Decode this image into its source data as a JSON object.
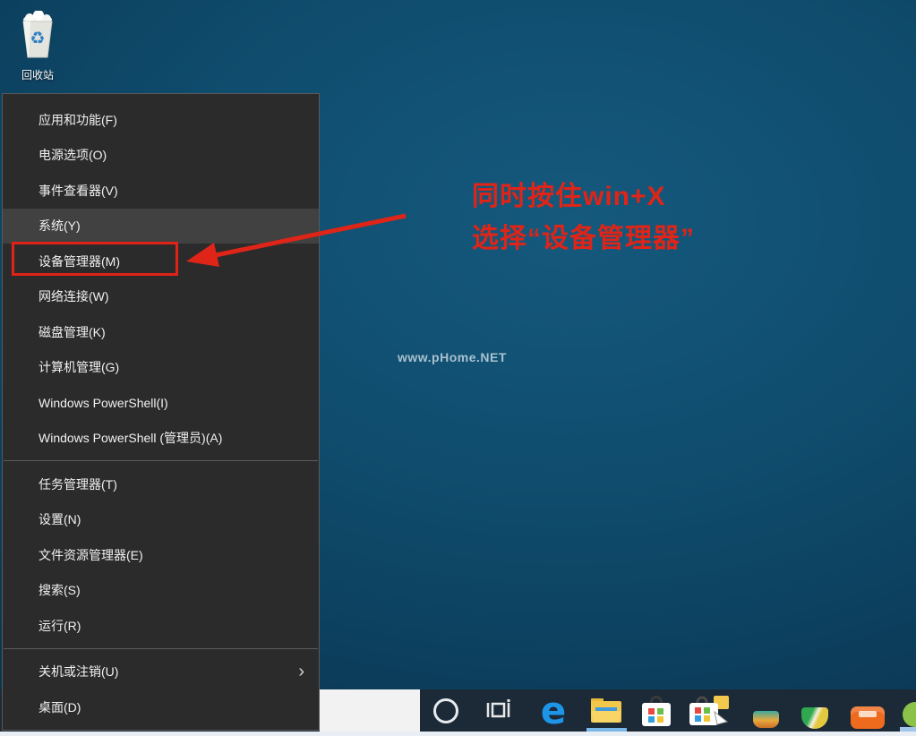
{
  "desktop": {
    "recycle_bin_label": "回收站",
    "watermark": "www.pHome.NET"
  },
  "annotation": {
    "line1": "同时按住win+X",
    "line2": "选择“设备管理器”"
  },
  "menu": {
    "items": [
      {
        "label": "应用和功能(F)"
      },
      {
        "label": "电源选项(O)"
      },
      {
        "label": "事件查看器(V)"
      },
      {
        "label": "系统(Y)",
        "state": "hover"
      },
      {
        "label": "设备管理器(M)",
        "state": "red-boxed"
      },
      {
        "label": "网络连接(W)"
      },
      {
        "label": "磁盘管理(K)"
      },
      {
        "label": "计算机管理(G)"
      },
      {
        "label": "Windows PowerShell(I)"
      },
      {
        "label": "Windows PowerShell (管理员)(A)"
      },
      {
        "label": "任务管理器(T)"
      },
      {
        "label": "设置(N)"
      },
      {
        "label": "文件资源管理器(E)"
      },
      {
        "label": "搜索(S)"
      },
      {
        "label": "运行(R)"
      },
      {
        "label": "关机或注销(U)",
        "has_submenu": true
      },
      {
        "label": "桌面(D)"
      }
    ]
  },
  "icons": {
    "recycle": "♻",
    "submenu_chevron": "›",
    "edge": "e",
    "cortana": "cortana-ring",
    "task_view": "task-view-glyph",
    "file_explorer": "yellow-folder",
    "store": "shopping-bag",
    "store_search": "shopping-bag-folder-search"
  },
  "colors": {
    "annotation_red": "#df2418",
    "menu_bg": "#2b2b2b",
    "menu_hover": "#414141",
    "taskbar_bg": "#1c2a38",
    "desktop_blue": "#0f4c6d",
    "explorer_underline": "#7ab8ea"
  }
}
